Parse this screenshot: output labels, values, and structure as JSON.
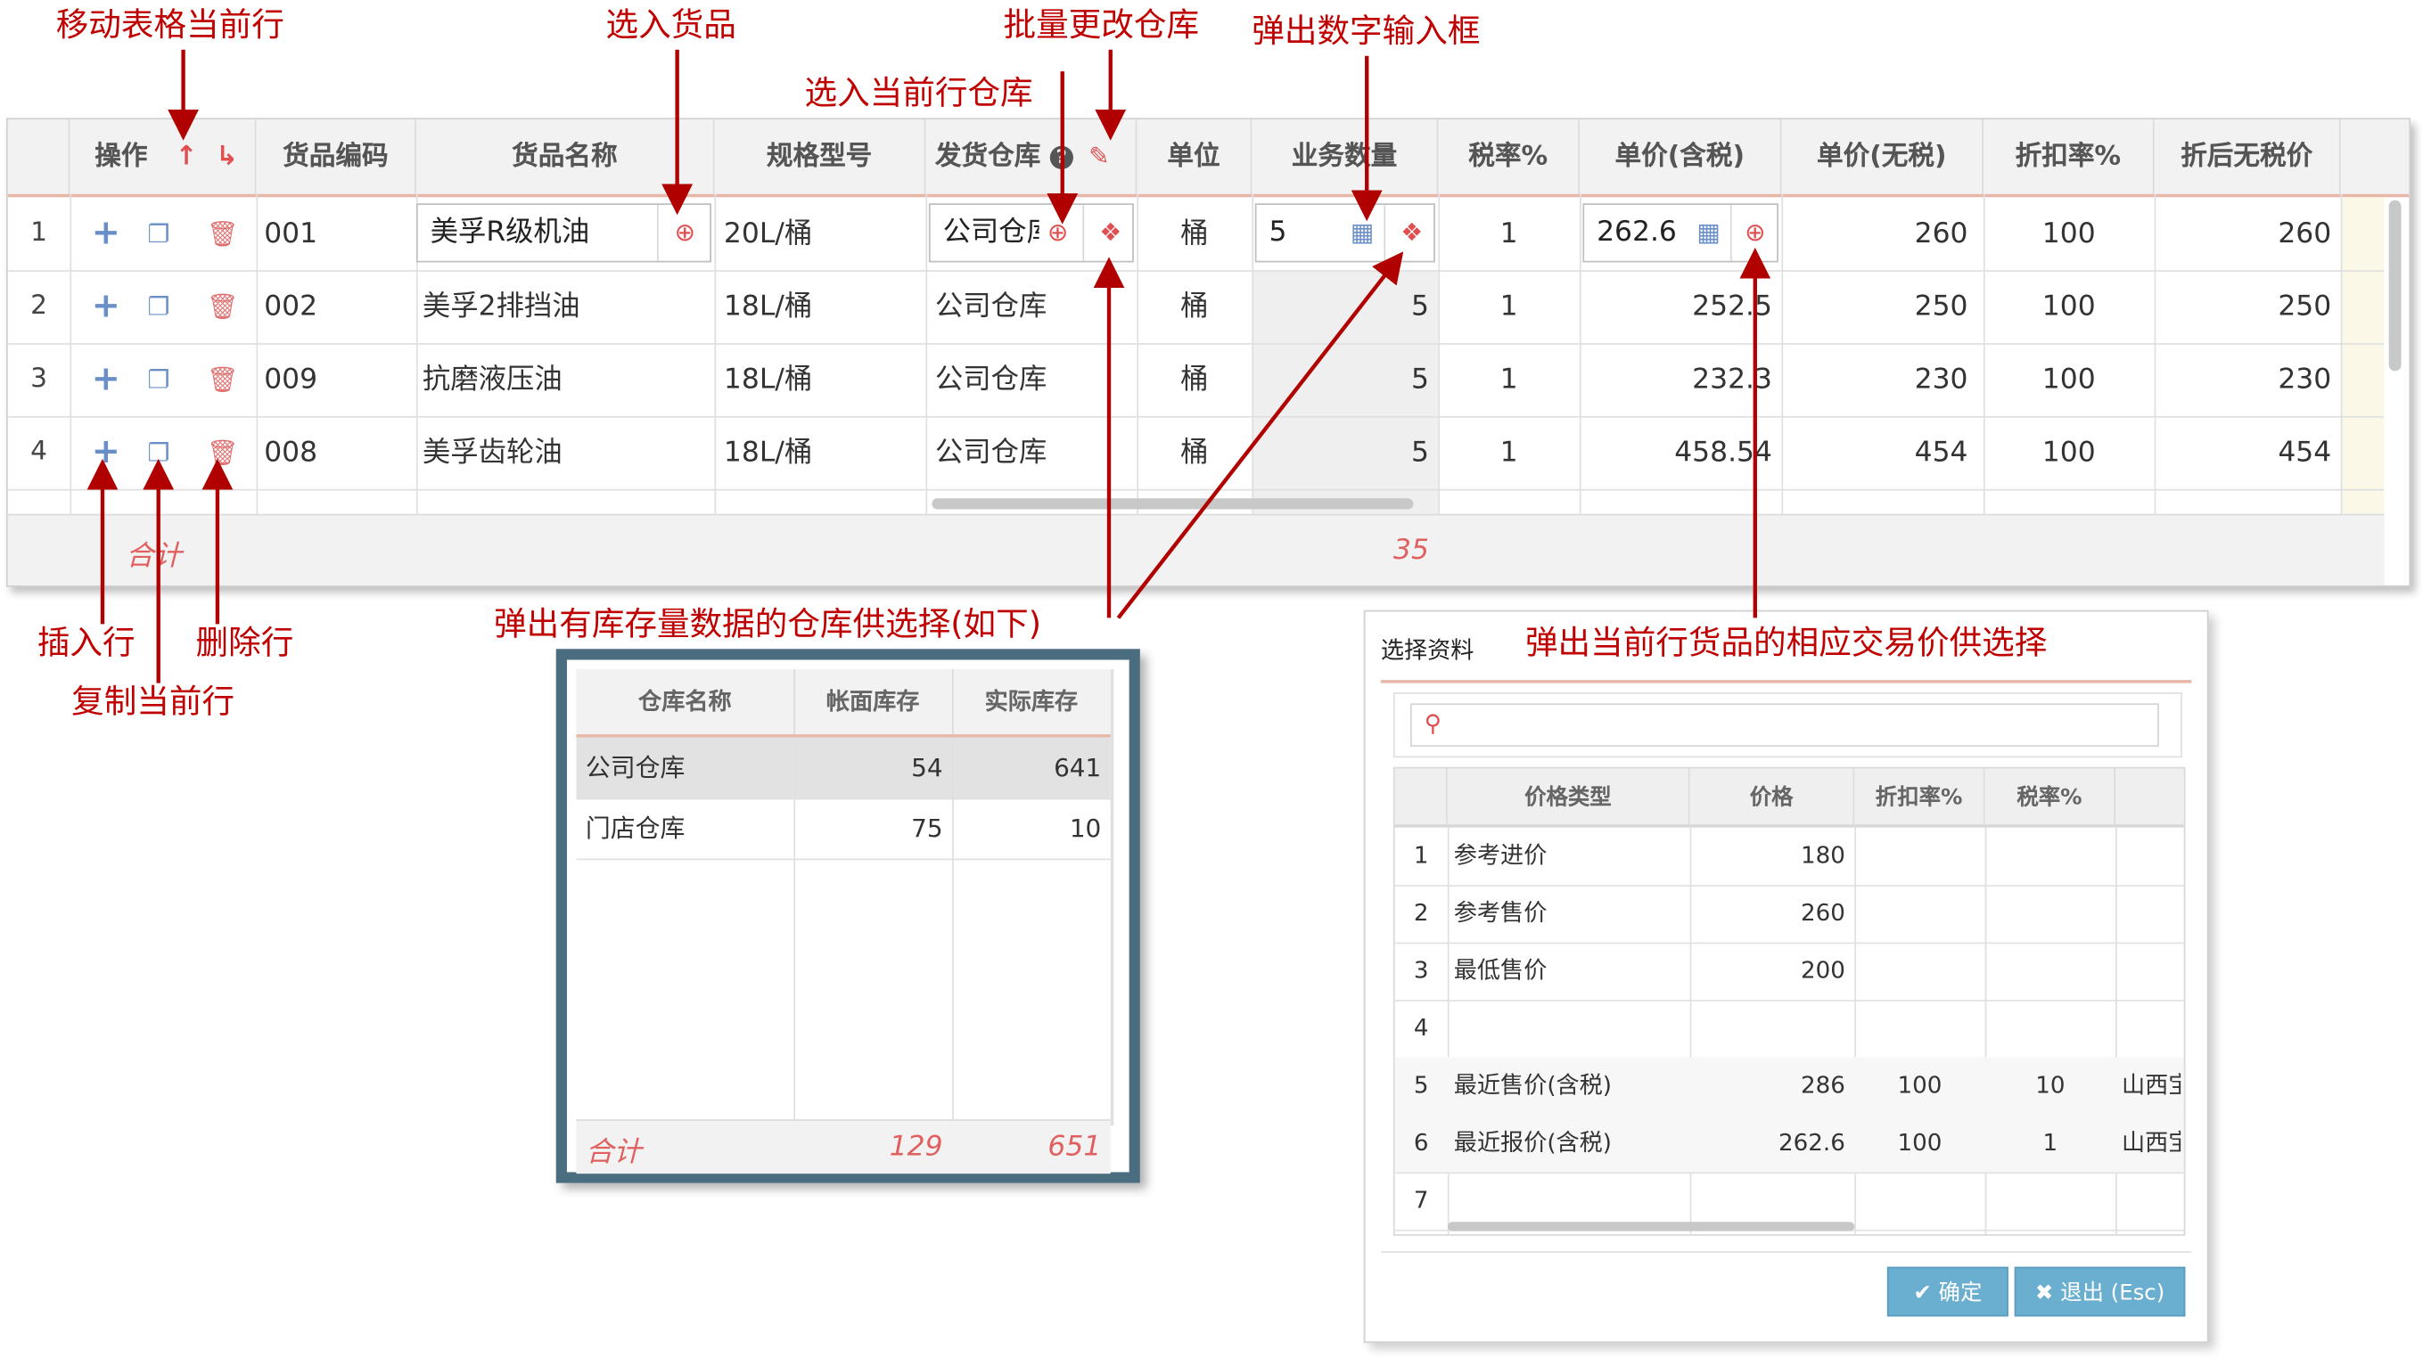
{
  "annotations": {
    "move_row": "移动表格当前行",
    "select_goods": "选入货品",
    "batch_warehouse": "批量更改仓库",
    "select_row_warehouse": "选入当前行仓库",
    "number_input": "弹出数字输入框",
    "insert_row": "插入行",
    "copy_row": "复制当前行",
    "delete_row": "删除行",
    "warehouse_popup": "弹出有库存量数据的仓库供选择(如下)",
    "price_popup": "弹出当前行货品的相应交易价供选择"
  },
  "main_grid": {
    "headers": [
      "操作",
      "货品编码",
      "货品名称",
      "规格型号",
      "发货仓库",
      "单位",
      "业务数量",
      "税率%",
      "单价(含税)",
      "单价(无税)",
      "折扣率%",
      "折后无税价"
    ],
    "rows": [
      {
        "no": "1",
        "code": "001",
        "name": "美孚R级机油",
        "spec": "20L/桶",
        "warehouse": "公司仓库",
        "unit": "桶",
        "qty": "5",
        "tax": "1",
        "price_tax": "262.6",
        "price": "260",
        "discount": "100",
        "net": "260"
      },
      {
        "no": "2",
        "code": "002",
        "name": "美孚2排挡油",
        "spec": "18L/桶",
        "warehouse": "公司仓库",
        "unit": "桶",
        "qty": "5",
        "tax": "1",
        "price_tax": "252.5",
        "price": "250",
        "discount": "100",
        "net": "250"
      },
      {
        "no": "3",
        "code": "009",
        "name": "抗磨液压油",
        "spec": "18L/桶",
        "warehouse": "公司仓库",
        "unit": "桶",
        "qty": "5",
        "tax": "1",
        "price_tax": "232.3",
        "price": "230",
        "discount": "100",
        "net": "230"
      },
      {
        "no": "4",
        "code": "008",
        "name": "美孚齿轮油",
        "spec": "18L/桶",
        "warehouse": "公司仓库",
        "unit": "桶",
        "qty": "5",
        "tax": "1",
        "price_tax": "458.54",
        "price": "454",
        "discount": "100",
        "net": "454"
      }
    ],
    "footer_label": "合计",
    "footer_qty": "35",
    "icons": {
      "move_up": "arrow-up-icon",
      "move_down": "arrow-down-icon",
      "help": "help-circle-icon",
      "batch_edit": "edit-icon",
      "insert": "plus-icon",
      "copy": "copy-icon",
      "delete": "trash-icon",
      "search": "search-icon",
      "stock": "boxes-icon",
      "calculator": "calculator-icon"
    }
  },
  "warehouse_popup": {
    "headers": [
      "仓库名称",
      "帐面库存",
      "实际库存"
    ],
    "rows": [
      {
        "name": "公司仓库",
        "book": "54",
        "actual": "641"
      },
      {
        "name": "门店仓库",
        "book": "75",
        "actual": "10"
      }
    ],
    "footer_label": "合计",
    "footer_book": "129",
    "footer_actual": "651"
  },
  "price_dialog": {
    "title": "选择资料",
    "search_placeholder": "",
    "headers": [
      "价格类型",
      "价格",
      "折扣率%",
      "税率%"
    ],
    "rows": [
      {
        "no": "1",
        "type": "参考进价",
        "price": "180",
        "discount": "",
        "tax": "",
        "extra": ""
      },
      {
        "no": "2",
        "type": "参考售价",
        "price": "260",
        "discount": "",
        "tax": "",
        "extra": ""
      },
      {
        "no": "3",
        "type": "最低售价",
        "price": "200",
        "discount": "",
        "tax": "",
        "extra": ""
      },
      {
        "no": "4",
        "type": "",
        "price": "",
        "discount": "",
        "tax": "",
        "extra": ""
      },
      {
        "no": "5",
        "type": "最近售价(含税)",
        "price": "286",
        "discount": "100",
        "tax": "10",
        "extra": "山西宝"
      },
      {
        "no": "6",
        "type": "最近报价(含税)",
        "price": "262.6",
        "discount": "100",
        "tax": "1",
        "extra": "山西宝"
      },
      {
        "no": "7",
        "type": "",
        "price": "",
        "discount": "",
        "tax": "",
        "extra": ""
      }
    ],
    "ok_label": "确定",
    "cancel_label": "退出 (Esc)"
  },
  "colors": {
    "annotation": "#c00000",
    "accent_red": "#e05050",
    "popup_border": "#4b6d80",
    "button": "#6aaed0"
  }
}
